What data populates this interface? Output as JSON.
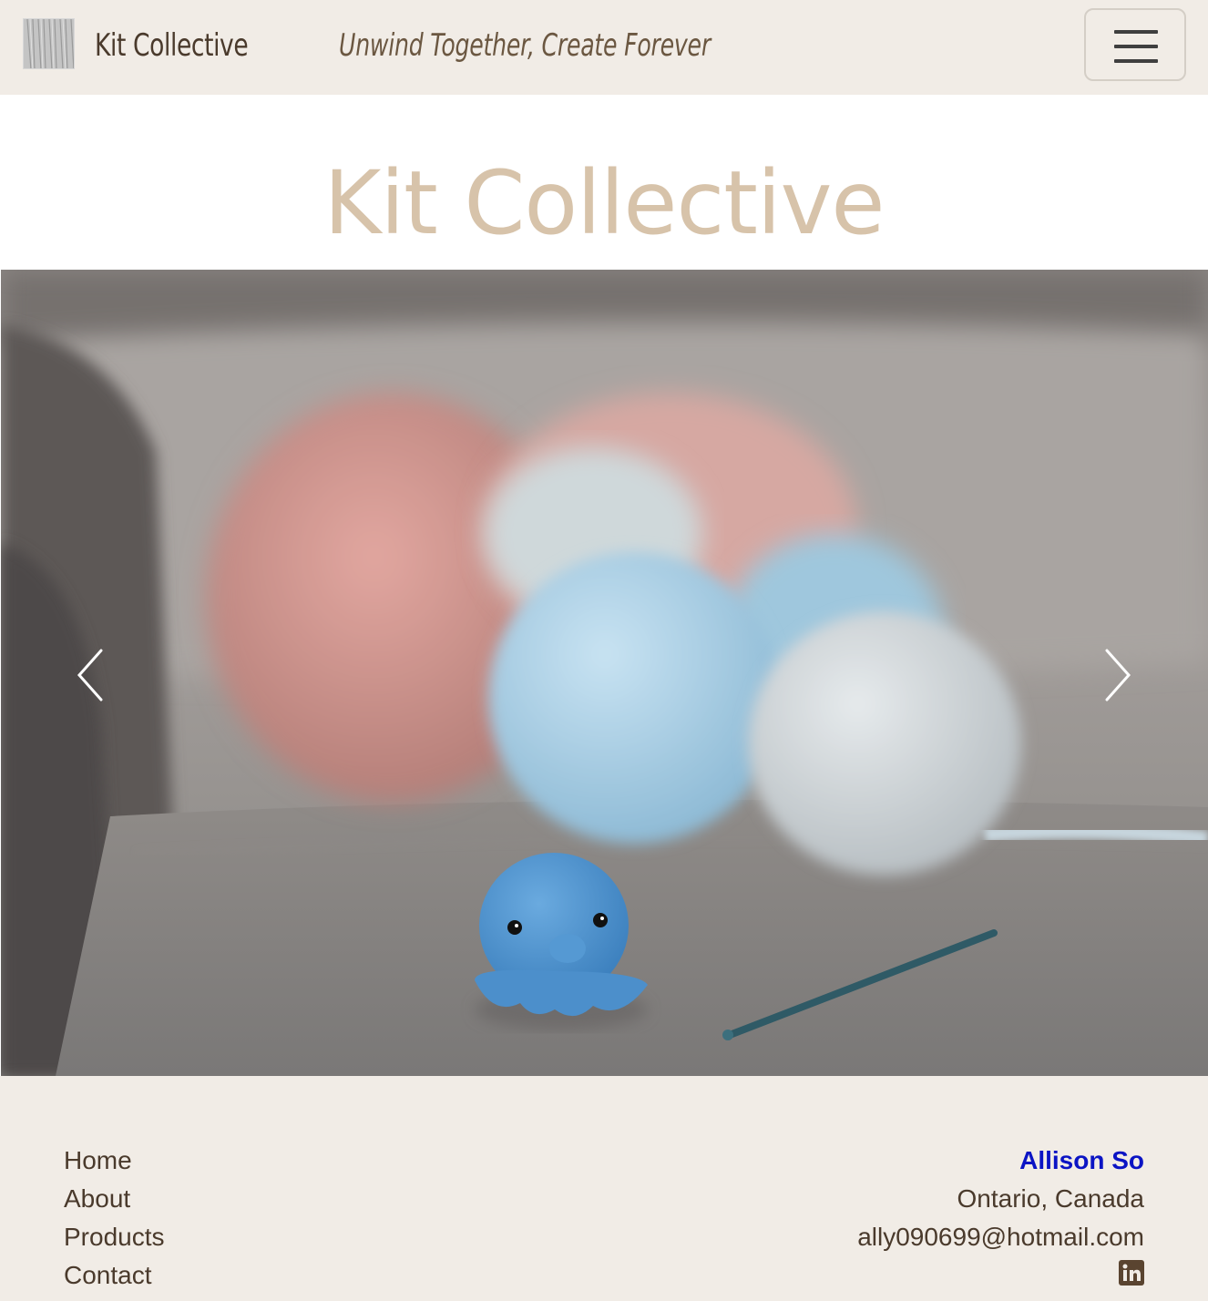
{
  "navbar": {
    "brand_name": "Kit Collective",
    "tagline": "Unwind Together, Create Forever",
    "toggler_icon": "hamburger-icon",
    "logo_icon": "yarn-texture-logo"
  },
  "hero": {
    "title": "Kit Collective"
  },
  "carousel": {
    "image_alt": "crochet octopus with yarn balls and crochet hook",
    "prev_icon": "chevron-left-icon",
    "next_icon": "chevron-right-icon"
  },
  "footer": {
    "nav": [
      {
        "label": "Home"
      },
      {
        "label": "About"
      },
      {
        "label": "Products"
      },
      {
        "label": "Contact"
      }
    ],
    "contact": {
      "name": "Allison So",
      "location": "Ontario, Canada",
      "email": "ally090699@hotmail.com",
      "social_icon": "linkedin-icon"
    }
  },
  "colors": {
    "nav_bg": "#f1ece6",
    "title": "#d7c3aa",
    "text_brown": "#4a3a2c",
    "link_blue": "#0b14c4"
  }
}
